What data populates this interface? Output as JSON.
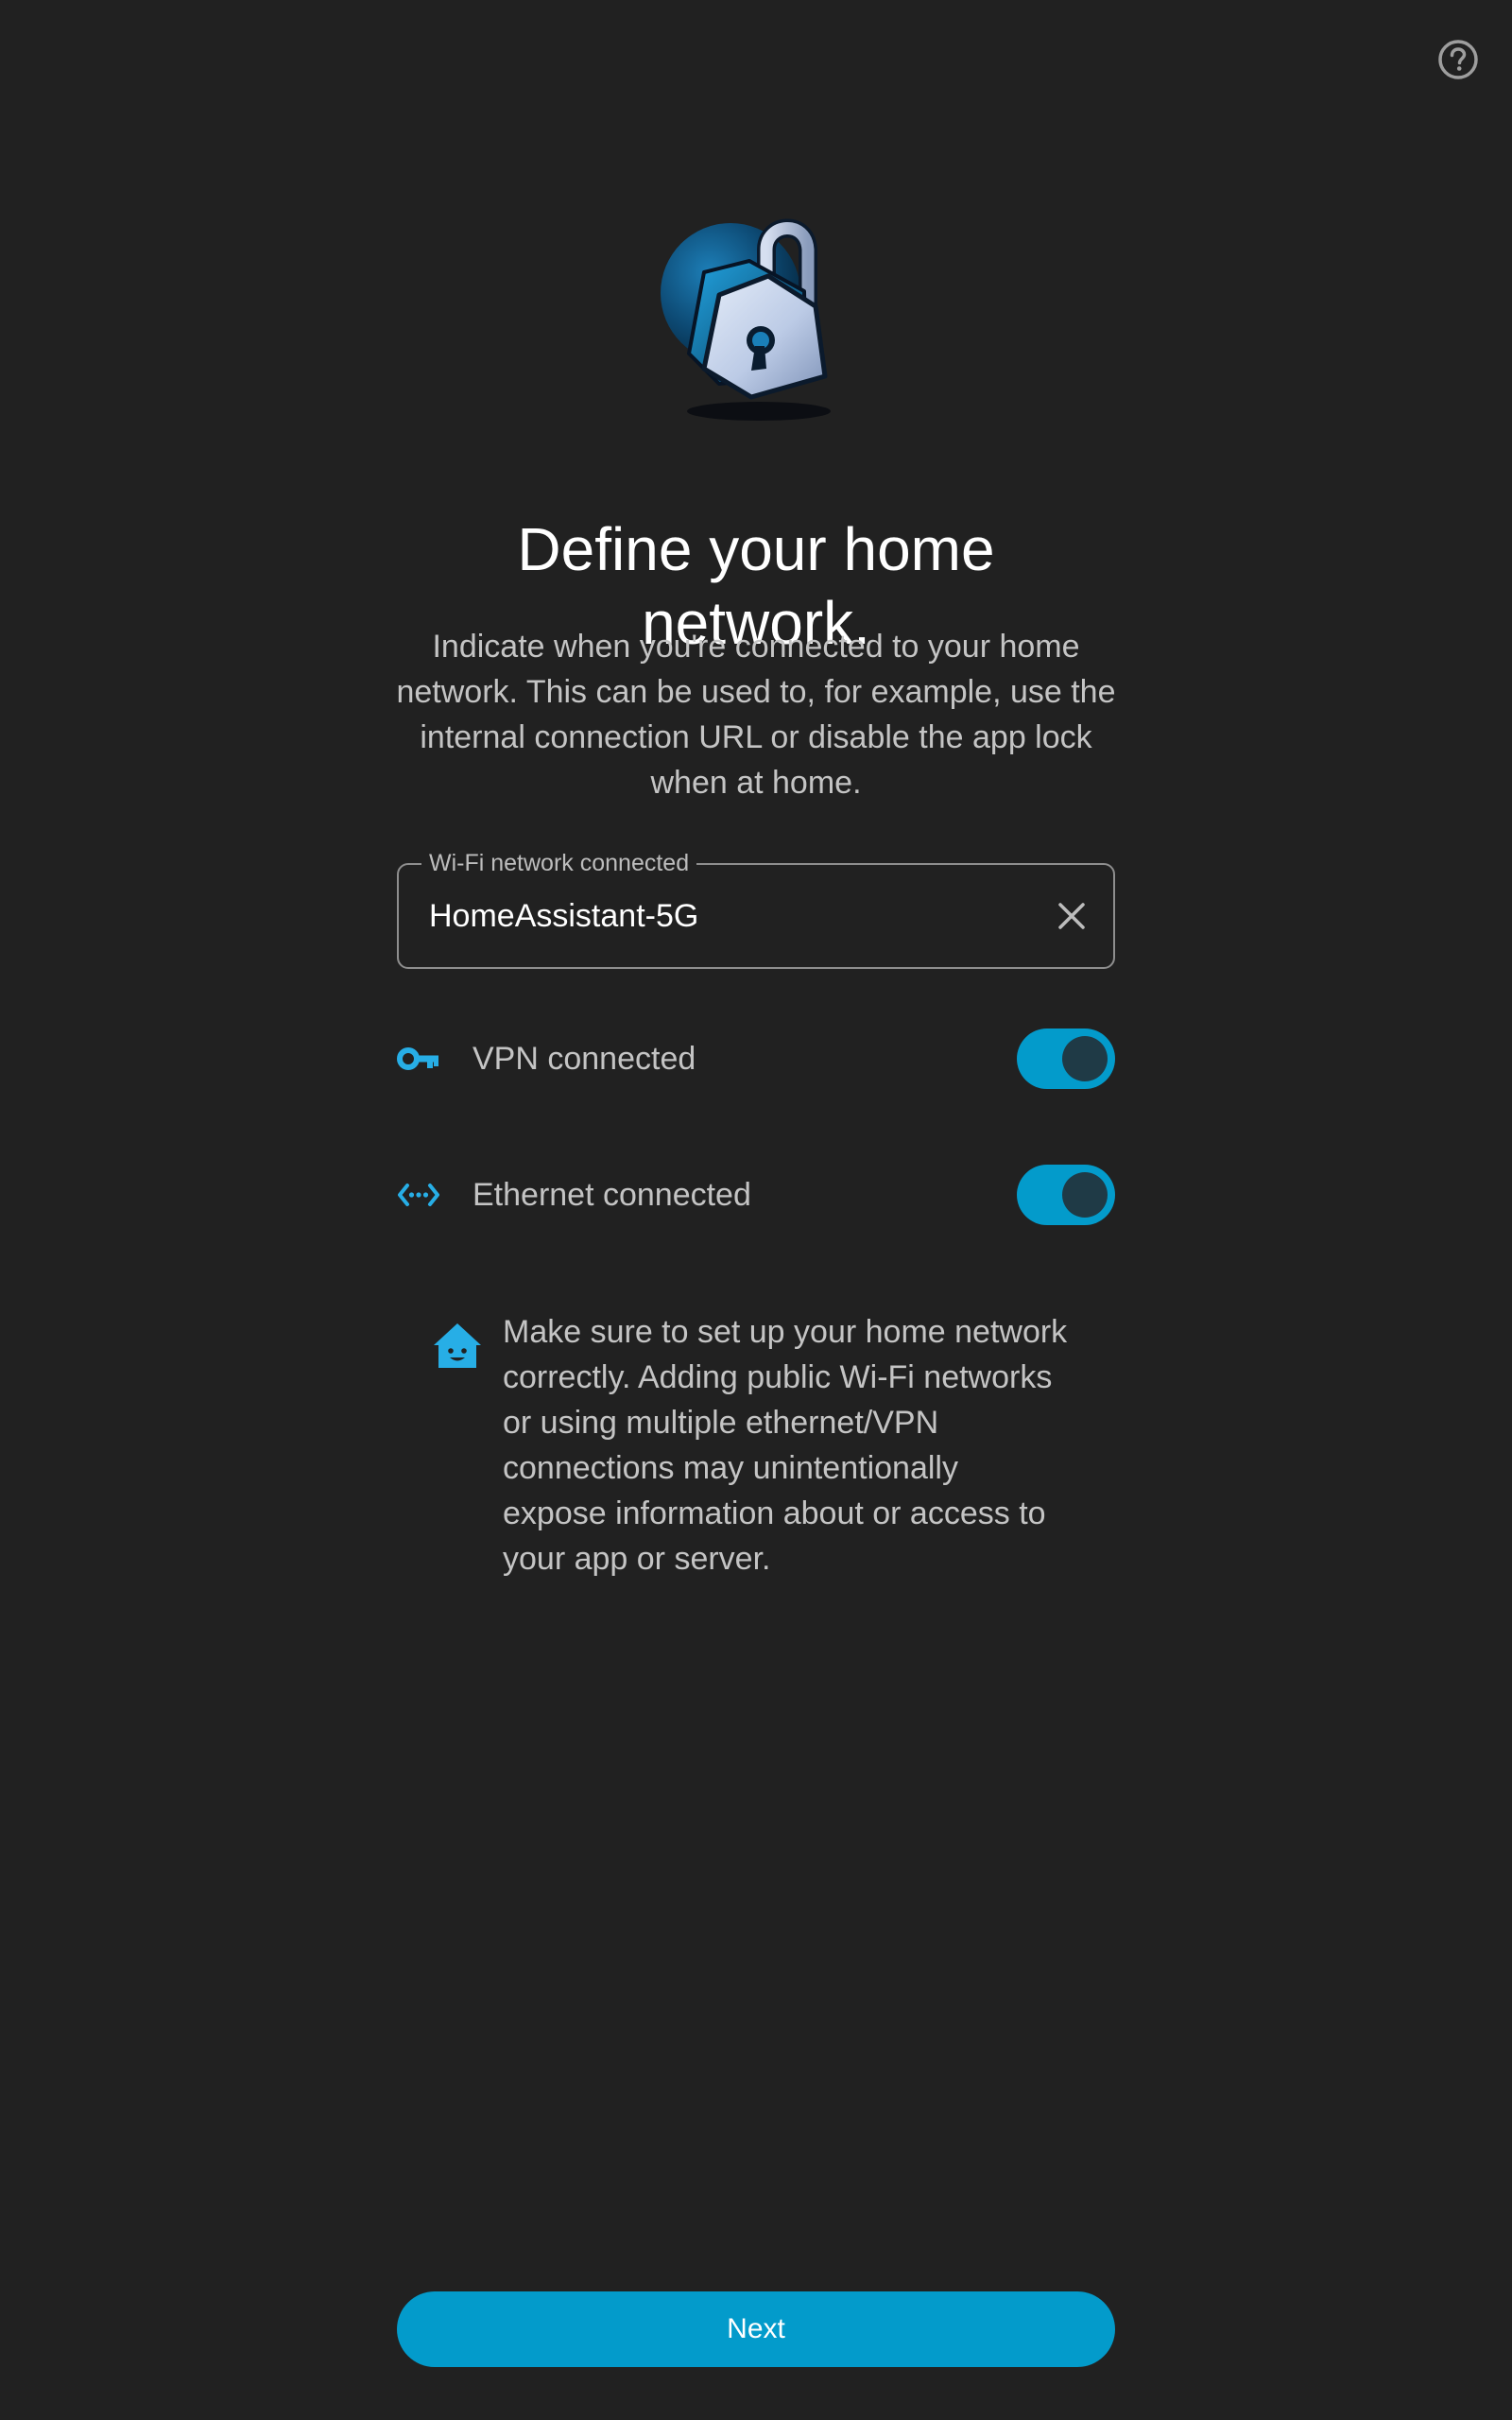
{
  "header": {
    "help_icon": "help-circle-icon"
  },
  "hero": {
    "icon": "padlock-illustration"
  },
  "title": "Define your home network.",
  "description": "Indicate when you're connected to your home network. This can be used to, for example, use the internal connection URL or disable the app lock when at home.",
  "wifi_field": {
    "label": "Wi-Fi network connected",
    "value": "HomeAssistant-5G",
    "clear_icon": "close-icon"
  },
  "toggles": [
    {
      "label": "VPN connected",
      "icon": "key-icon",
      "checked": true
    },
    {
      "label": "Ethernet connected",
      "icon": "ethernet-icon",
      "checked": true
    }
  ],
  "note": {
    "icon": "home-assistant-icon",
    "text": "Make sure to set up your home network correctly. Adding public Wi-Fi networks or using multiple ethernet/VPN connections may unintentionally expose information about or access to your app or server."
  },
  "next_button": {
    "label": "Next"
  },
  "colors": {
    "background": "#212121",
    "accent": "#039bcb",
    "icon_accent": "#27aee6",
    "text_primary": "#ffffff",
    "text_secondary": "#c4c4c4"
  }
}
